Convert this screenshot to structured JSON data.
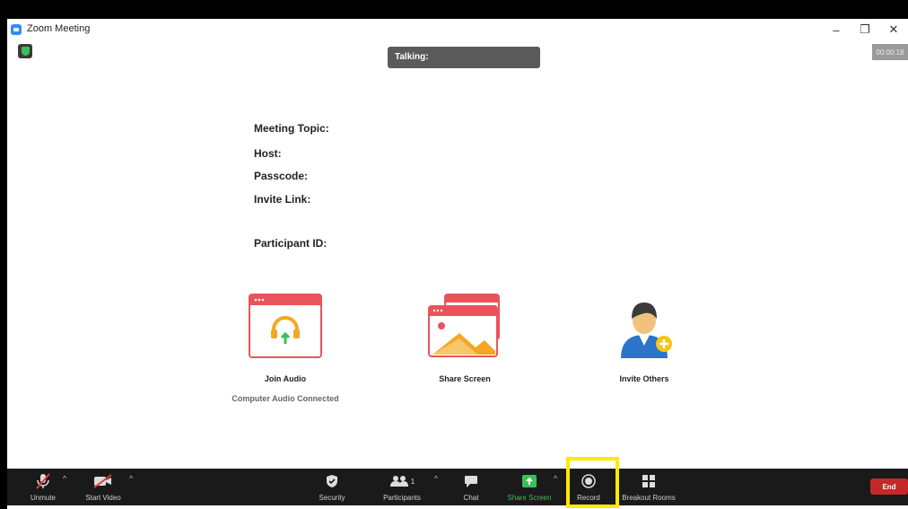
{
  "window": {
    "title": "Zoom Meeting",
    "controls": {
      "minimize": "–",
      "restore": "❐",
      "close": "✕"
    },
    "timer": "00:00:18",
    "talking_label": "Talking:"
  },
  "meeting_info": {
    "topic_label": "Meeting Topic:",
    "host_label": "Host:",
    "passcode_label": "Passcode:",
    "invite_link_label": "Invite Link:",
    "participant_id_label": "Participant ID:"
  },
  "actions": {
    "join_audio": {
      "label": "Join Audio",
      "status": "Computer Audio Connected"
    },
    "share_screen": {
      "label": "Share Screen"
    },
    "invite_others": {
      "label": "Invite Others"
    }
  },
  "toolbar": {
    "unmute": "Unmute",
    "start_video": "Start Video",
    "security": "Security",
    "participants": "Participants",
    "participants_count": "1",
    "chat": "Chat",
    "share_screen": "Share Screen",
    "record": "Record",
    "breakout_rooms": "Breakout Rooms",
    "end": "End"
  },
  "colors": {
    "accent_green": "#3cbf57",
    "end_red": "#c62828",
    "toolbar_bg": "#1a1a1a",
    "highlight": "#ffeb00",
    "illustration_red": "#e9545a",
    "illustration_orange": "#f5a623"
  },
  "icons": {
    "app": "zoom-logo-icon",
    "security_badge": "shield-check-icon",
    "unmute": "muted-microphone-icon",
    "video": "video-off-icon",
    "security": "shield-icon",
    "participants": "people-icon",
    "chat": "chat-bubble-icon",
    "share": "share-arrow-icon",
    "record": "record-circle-icon",
    "breakout": "grid-icon"
  }
}
